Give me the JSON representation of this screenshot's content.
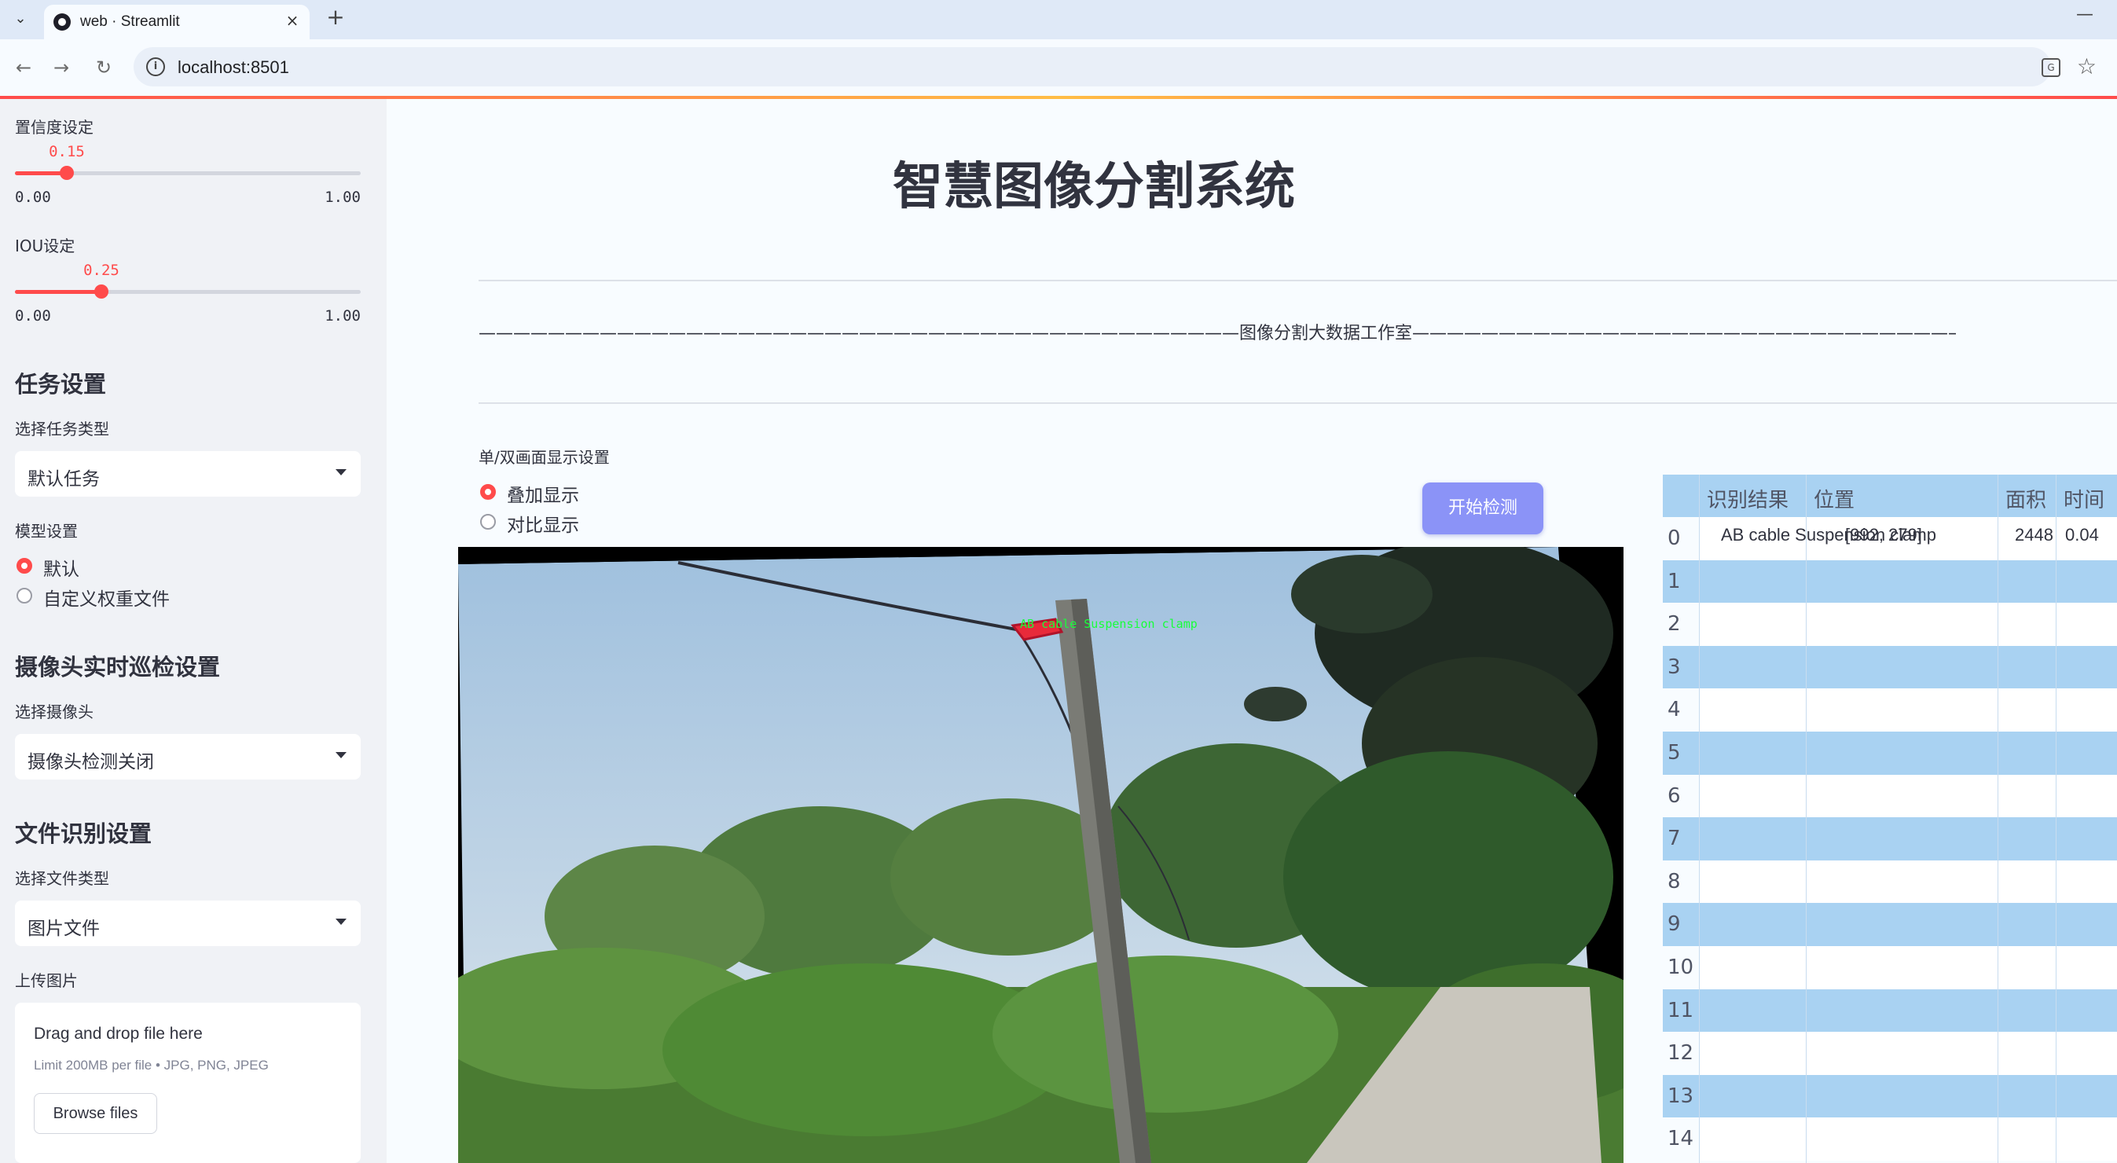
{
  "browser": {
    "tab_title": "web · Streamlit",
    "url": "localhost:8501"
  },
  "sidebar": {
    "confidence": {
      "label": "置信度设定",
      "value": "0.15",
      "fraction": 0.15,
      "min": "0.00",
      "max": "1.00"
    },
    "iou": {
      "label": "IOU设定",
      "value": "0.25",
      "fraction": 0.25,
      "min": "0.00",
      "max": "1.00"
    },
    "task_heading": "任务设置",
    "task_label": "选择任务类型",
    "task_value": "默认任务",
    "model_label": "模型设置",
    "model_options": [
      "默认",
      "自定义权重文件"
    ],
    "camera_heading": "摄像头实时巡检设置",
    "camera_label": "选择摄像头",
    "camera_value": "摄像头检测关闭",
    "file_heading": "文件识别设置",
    "file_type_label": "选择文件类型",
    "file_type_value": "图片文件",
    "upload_label": "上传图片",
    "dropzone_title": "Drag and drop file here",
    "dropzone_limit": "Limit 200MB per file • JPG, PNG, JPEG",
    "browse_label": "Browse files"
  },
  "main": {
    "title": "智慧图像分割系统",
    "studio_line": "————————————————————————————————————————————图像分割大数据工作室————————————————————————————————————————————",
    "display_mode_label": "单/双画面显示设置",
    "display_options": [
      "叠加显示",
      "对比显示"
    ],
    "start_button": "开始检测",
    "detection_label": "AB cable Suspension clamp"
  },
  "results_table": {
    "columns": [
      "识别结果",
      "位置",
      "面积",
      "时间"
    ],
    "rows": [
      {
        "index": "0",
        "result": "AB cable Suspension clamp",
        "position": "[992, 279]",
        "area": "2448",
        "time": "0.04"
      },
      {
        "index": "1"
      },
      {
        "index": "2"
      },
      {
        "index": "3"
      },
      {
        "index": "4"
      },
      {
        "index": "5"
      },
      {
        "index": "6"
      },
      {
        "index": "7"
      },
      {
        "index": "8"
      },
      {
        "index": "9"
      },
      {
        "index": "10"
      },
      {
        "index": "11"
      },
      {
        "index": "12"
      },
      {
        "index": "13"
      },
      {
        "index": "14"
      }
    ]
  },
  "colors": {
    "accent": "#ff4b4b",
    "button": "#8b93f7",
    "table_stripe": "#a9d2f2",
    "sidebar_bg": "#f0f2f6"
  },
  "icons": [
    "chevron-down-icon",
    "close-icon",
    "plus-icon",
    "back-arrow-icon",
    "forward-arrow-icon",
    "reload-icon",
    "info-icon",
    "translate-icon",
    "star-icon"
  ]
}
